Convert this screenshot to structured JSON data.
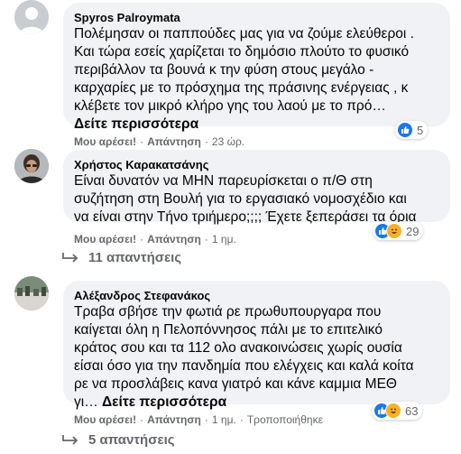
{
  "comments": [
    {
      "author": "Spyros Palroymata",
      "text": "Πολέμησαν οι παππούδες μας για να ζούμε ελεύθεροι .\nΚαι τώρα εσείς χαρίζεται το δημόσιο πλούτο το φυσικό\nπεριβάλλον τα βουνά κ την φύση στους μεγάλο -\nκαρχαρίες με το πρόσχημα της πράσινης ενέργειας , κ\nκλέβετε τον μικρό κλήρο γης του λαού με το πρό…",
      "see_more": "Δείτε περισσότερα",
      "like": "Μου αρέσει!",
      "reply": "Απάντηση",
      "time": "23 ώρ.",
      "reaction_count": "5"
    },
    {
      "author": "Χρήστος Καρακατσάνης",
      "text": "Είναι δυνατόν να ΜΗΝ παρευρίσκεται ο π/Θ στη\nσυζήτηση στη Βουλή για το εργασιακό νομοσχέδιο και\nνα είναι στην Τήνο τριήμερο;;;; Έχετε ξεπεράσει τα όρια",
      "like": "Μου αρέσει!",
      "reply": "Απάντηση",
      "time": "1 ημ.",
      "reaction_count": "29",
      "replies_label": "11 απαντήσεις"
    },
    {
      "author": "Αλέξανδρος Στεφανάκος",
      "text": "Τραβα σβήσε την φωτιά ρε πρωθυπουργαρα που\nκαίγεται όλη η Πελοπόννησος πάλι με το επιτελικό\nκράτος σου και τα 112 ολο ανακοινώσεις χωρίς ουσία\nείσαι όσο για την πανδημία που ελέγχεις και καλά κοίτα\nρε να προσλάβεις κανα γιατρό και κάνε καμμια ΜΕΘ\nγι…",
      "see_more": "Δείτε περισσότερα",
      "like": "Μου αρέσει!",
      "reply": "Απάντηση",
      "time": "1 ημ.",
      "edited": "Τροποποιήθηκε",
      "reaction_count": "63",
      "replies_label": "5 απαντήσεις"
    }
  ],
  "colors": {
    "bubble": "#f0f2f5",
    "meta_text": "#65676b",
    "like_blue": "#1877f2",
    "haha_yellow": "#f7b125"
  }
}
